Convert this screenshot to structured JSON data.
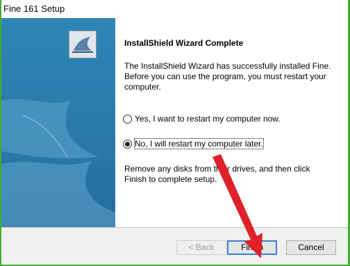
{
  "window": {
    "title": "Fine 161 Setup"
  },
  "wizard": {
    "heading": "InstallShield Wizard Complete",
    "message": "The InstallShield Wizard has successfully installed Fine. Before you can use the program, you must restart your computer.",
    "options": [
      {
        "label": "Yes, I want to restart my computer now.",
        "selected": false
      },
      {
        "label": "No, I will restart my computer later.",
        "selected": true
      }
    ],
    "info": "Remove any disks from their drives, and then click Finish to complete setup."
  },
  "buttons": {
    "back": "< Back",
    "finish": "Finish",
    "cancel": "Cancel"
  },
  "colors": {
    "accent": "#3a7bd6",
    "arrow": "#e0202a",
    "side_panel": "#2f86b6",
    "frame": "#3fae2e"
  },
  "icons": [
    "installshield-logo-icon",
    "sail-watermark-icon"
  ]
}
